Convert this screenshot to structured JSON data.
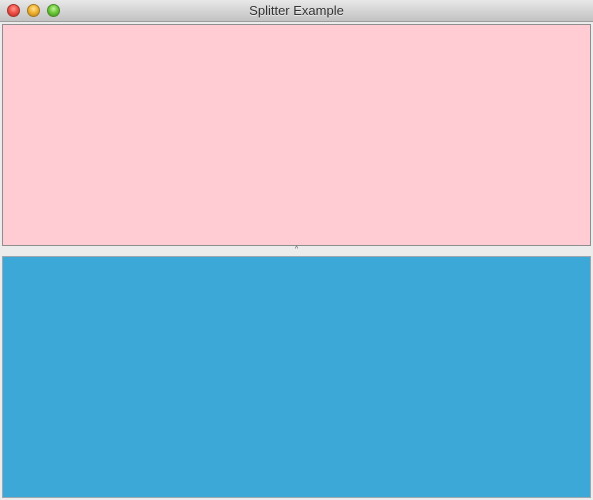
{
  "window": {
    "title": "Splitter Example",
    "controls": {
      "close_icon": "close-icon",
      "minimize_icon": "minimize-icon",
      "zoom_icon": "zoom-icon"
    }
  },
  "splitter": {
    "orientation": "vertical",
    "grip_icon": "splitter-grip-icon",
    "top_pane": {
      "color": "#ffccd4"
    },
    "bottom_pane": {
      "color": "#3ca8d8"
    }
  }
}
